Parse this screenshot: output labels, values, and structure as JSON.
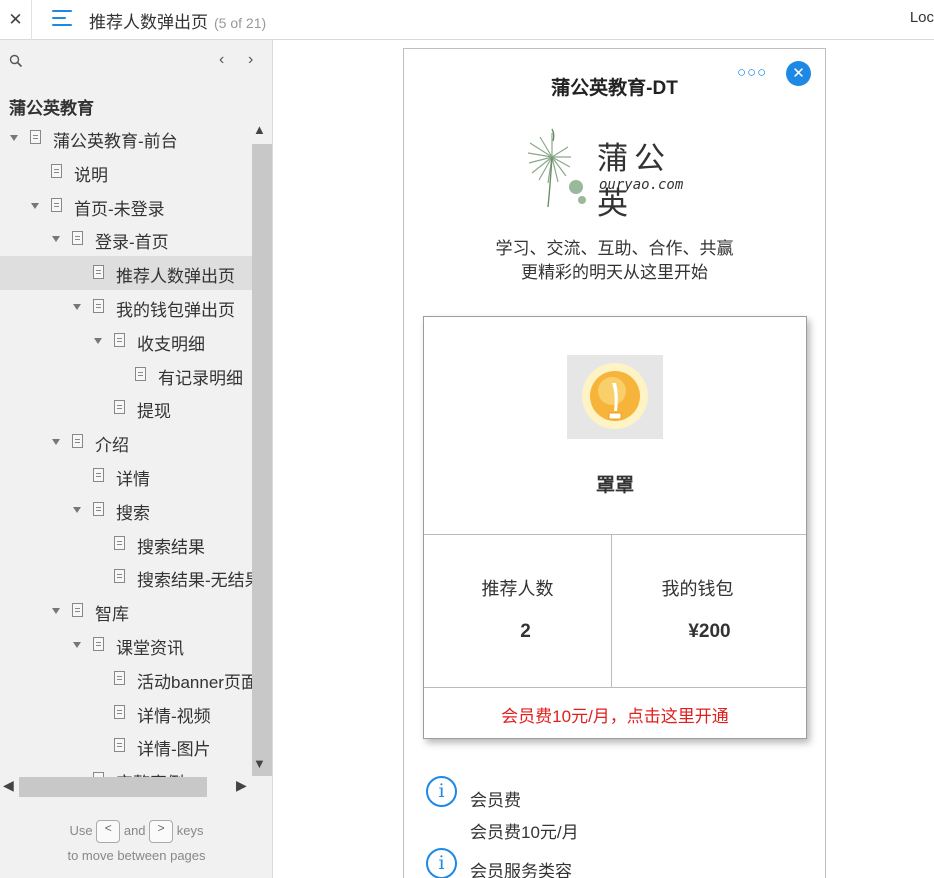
{
  "topbar": {
    "close_glyph": "✕",
    "page_title": "推荐人数弹出页",
    "page_count": "(5 of 21)",
    "right_text": "Loc"
  },
  "sidebar": {
    "prev_glyph": "‹",
    "next_glyph": "›",
    "project_name": "蒲公英教育",
    "tree": [
      {
        "label": "蒲公英教育-前台",
        "level": 0,
        "caret": true
      },
      {
        "label": "说明",
        "level": 1,
        "caret": false
      },
      {
        "label": "首页-未登录",
        "level": 1,
        "caret": true
      },
      {
        "label": "登录-首页",
        "level": 2,
        "caret": true
      },
      {
        "label": "推荐人数弹出页",
        "level": 3,
        "caret": false,
        "selected": true
      },
      {
        "label": "我的钱包弹出页",
        "level": 3,
        "caret": true
      },
      {
        "label": "收支明细",
        "level": 4,
        "caret": true
      },
      {
        "label": "有记录明细",
        "level": 5,
        "caret": false
      },
      {
        "label": "提现",
        "level": 4,
        "caret": false
      },
      {
        "label": "介绍",
        "level": 2,
        "caret": true
      },
      {
        "label": "详情",
        "level": 3,
        "caret": false
      },
      {
        "label": "搜索",
        "level": 3,
        "caret": true
      },
      {
        "label": "搜索结果",
        "level": 4,
        "caret": false
      },
      {
        "label": "搜索结果-无结果",
        "level": 4,
        "caret": false
      },
      {
        "label": "智库",
        "level": 2,
        "caret": true
      },
      {
        "label": "课堂资讯",
        "level": 3,
        "caret": true
      },
      {
        "label": "活动banner页面",
        "level": 4,
        "caret": false
      },
      {
        "label": "详情-视频",
        "level": 4,
        "caret": false
      },
      {
        "label": "详情-图片",
        "level": 4,
        "caret": false
      },
      {
        "label": "完整案例",
        "level": 3,
        "caret": true
      }
    ],
    "hint": {
      "use": "Use",
      "key_prev": "<",
      "and": "and",
      "key_next": ">",
      "keys": "keys",
      "line2": "to move between pages"
    }
  },
  "preview": {
    "app_title": "蒲公英教育-DT",
    "more_glyph": "○○○",
    "close_glyph": "✕",
    "logo_cn": "蒲公英",
    "logo_en": "ouryao.com",
    "slogan_line1": "学习、交流、互助、合作、共赢",
    "slogan_line2": "更精彩的明天从这里开始",
    "card": {
      "username": "罩罩",
      "referrals_label": "推荐人数",
      "referrals_value": "2",
      "wallet_label": "我的钱包",
      "wallet_value": "¥200",
      "vip_text": "会员费10元/月，点击这里开通"
    },
    "info": [
      {
        "icon": "i",
        "title": "会员费",
        "detail": "会员费10元/月"
      },
      {
        "icon": "i",
        "title": "会员服务类容",
        "detail": ""
      }
    ]
  },
  "colors": {
    "accent": "#1e88e5",
    "vip_red": "#e0201e",
    "sidebar_bg": "#f1f1f1",
    "selected_bg": "#dedede"
  }
}
